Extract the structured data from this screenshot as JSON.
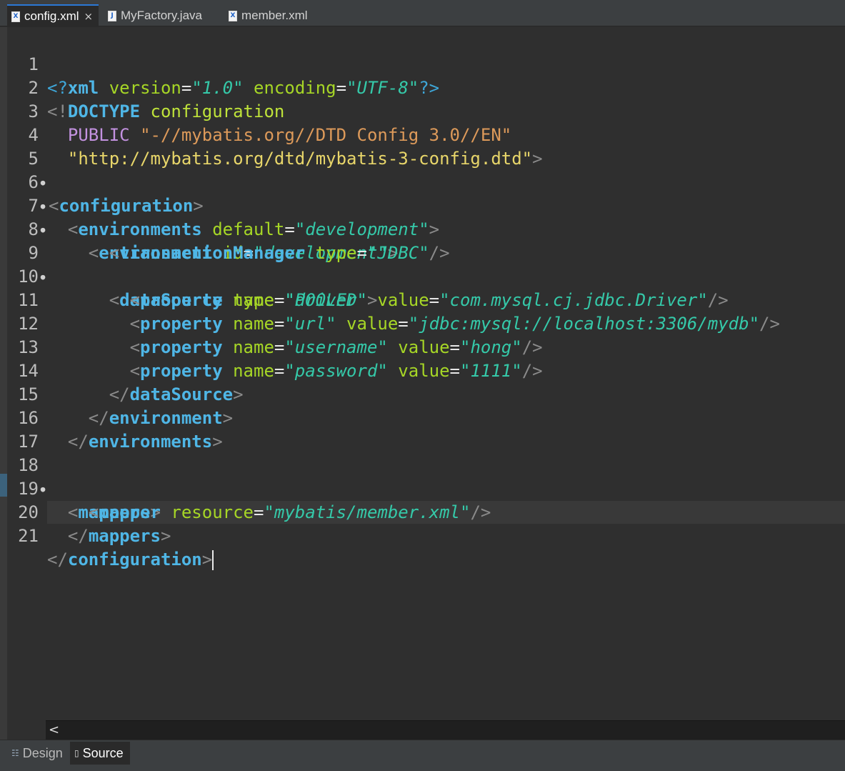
{
  "tabs": [
    {
      "label": "config.xml",
      "icon": "xml-file-icon",
      "active": true,
      "close": "×"
    },
    {
      "label": "MyFactory.java",
      "icon": "java-file-icon",
      "active": false
    },
    {
      "label": "member.xml",
      "icon": "xml-file-icon",
      "active": false
    }
  ],
  "line_numbers": [
    "1",
    "2",
    "3",
    "4",
    "5",
    "6",
    "7",
    "8",
    "9",
    "10",
    "11",
    "12",
    "13",
    "14",
    "15",
    "16",
    "17",
    "18",
    "19",
    "20",
    "21"
  ],
  "code": {
    "xml_decl": "xml",
    "version_attr": "version",
    "version_val": "\"1.0\"",
    "encoding_attr": "encoding",
    "encoding_val": "\"UTF-8\"",
    "doctype": "DOCTYPE",
    "doctype_name": "configuration",
    "public": "PUBLIC",
    "public_id": "\"-//mybatis.org//DTD Config 3.0//EN\"",
    "system_id": "\"http://mybatis.org/dtd/mybatis-3-config.dtd\"",
    "configuration": "configuration",
    "environments": "environments",
    "default_attr": "default",
    "default_val": "\"development\"",
    "environment": "environment",
    "id_attr": "id",
    "id_val": "\"development\"",
    "transactionManager": "transactionManager",
    "type_attr": "type",
    "tm_type_val": "\"JDBC\"",
    "dataSource": "dataSource",
    "ds_type_val": "\"POOLED\"",
    "property": "property",
    "name_attr": "name",
    "value_attr": "value",
    "p1_name": "\"driver\"",
    "p1_value": "\"com.mysql.cj.jdbc.Driver\"",
    "p2_name": "\"url\"",
    "p2_value": "\"jdbc:mysql://localhost:3306/mydb\"",
    "p3_name": "\"username\"",
    "p3_value": "\"hong\"",
    "p4_name": "\"password\"",
    "p4_value": "\"1111\"",
    "mappers": "mappers",
    "mapper": "mapper",
    "resource_attr": "resource",
    "resource_val": "\"mybatis/member.xml\""
  },
  "bottom_tabs": [
    {
      "label": "Design",
      "active": false
    },
    {
      "label": "Source",
      "active": true
    }
  ],
  "scroll_left": "<"
}
